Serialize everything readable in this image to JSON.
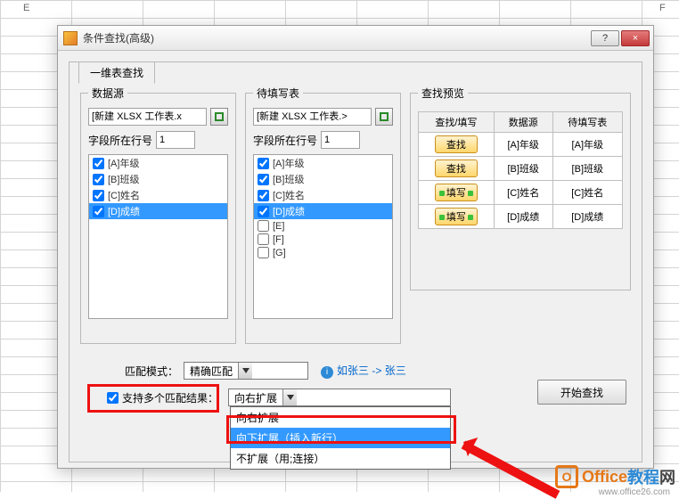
{
  "col_headers": {
    "e": "E",
    "f": "F"
  },
  "dialog": {
    "title": "条件查找(高级)",
    "tab": "一维表查找",
    "help_btn": "?",
    "close_btn": "×"
  },
  "source": {
    "legend": "数据源",
    "path": "[新建 XLSX 工作表.x",
    "row_label": "字段所在行号",
    "row_value": "1",
    "items": [
      {
        "label": "[A]年级",
        "checked": true
      },
      {
        "label": "[B]班级",
        "checked": true
      },
      {
        "label": "[C]姓名",
        "checked": true
      },
      {
        "label": "[D]成绩",
        "checked": true,
        "selected": true
      }
    ]
  },
  "target": {
    "legend": "待填写表",
    "path": "[新建 XLSX 工作表.>",
    "row_label": "字段所在行号",
    "row_value": "1",
    "items": [
      {
        "label": "[A]年级",
        "checked": true
      },
      {
        "label": "[B]班级",
        "checked": true
      },
      {
        "label": "[C]姓名",
        "checked": true
      },
      {
        "label": "[D]成绩",
        "checked": true,
        "selected": true
      },
      {
        "label": "[E]",
        "checked": false
      },
      {
        "label": "[F]",
        "checked": false
      },
      {
        "label": "[G]",
        "checked": false
      }
    ]
  },
  "preview": {
    "legend": "查找预览",
    "headers": {
      "c1": "查找/填写",
      "c2": "数据源",
      "c3": "待填写表"
    },
    "rows": [
      {
        "btn": "查找",
        "kind": "find",
        "src": "[A]年级",
        "tgt": "[A]年级"
      },
      {
        "btn": "查找",
        "kind": "find",
        "src": "[B]班级",
        "tgt": "[B]班级"
      },
      {
        "btn": "填写",
        "kind": "fill",
        "src": "[C]姓名",
        "tgt": "[C]姓名"
      },
      {
        "btn": "填写",
        "kind": "fill",
        "src": "[D]成绩",
        "tgt": "[D]成绩"
      }
    ]
  },
  "match_mode": {
    "label": "匹配模式：",
    "value": "精确匹配",
    "hint": "如张三 -> 张三"
  },
  "multi": {
    "label": "支持多个匹配结果：",
    "checked": true,
    "value": "向右扩展",
    "options": [
      "向右扩展",
      "向下扩展（插入新行）",
      "不扩展（用;连接）"
    ],
    "selected_index": 1
  },
  "start_btn": "开始查找",
  "watermark": {
    "t1": "Office",
    "t2": "教程",
    "t3": "网",
    "url": "www.office26.com"
  }
}
